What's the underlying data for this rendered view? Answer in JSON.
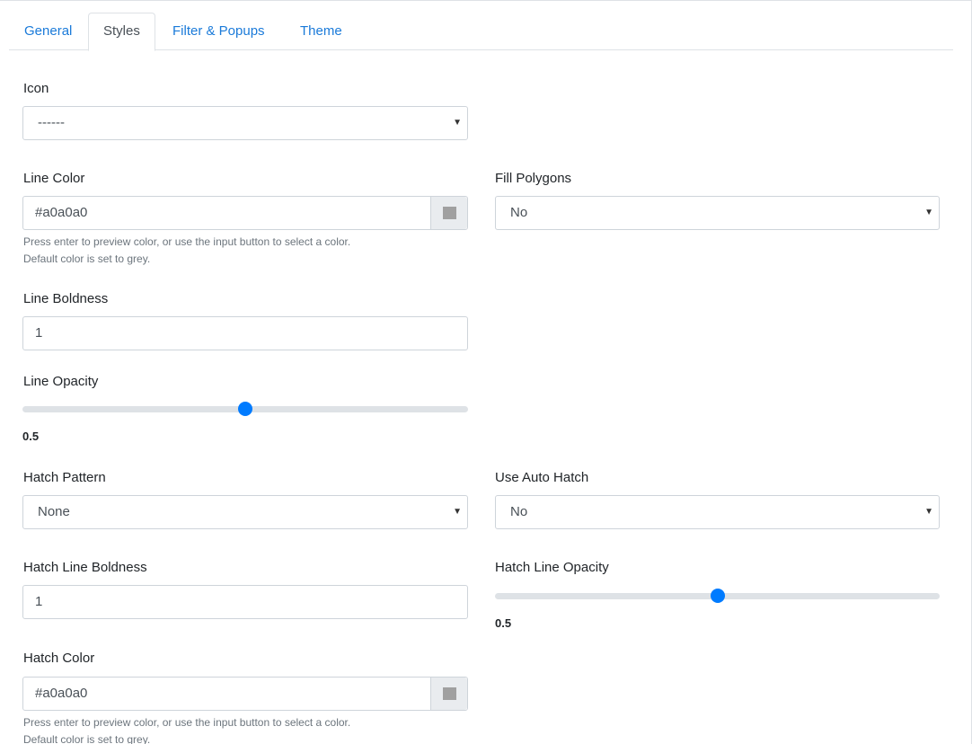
{
  "tabs": [
    {
      "label": "General",
      "active": false
    },
    {
      "label": "Styles",
      "active": true
    },
    {
      "label": "Filter & Popups",
      "active": false
    },
    {
      "label": "Theme",
      "active": false
    }
  ],
  "icon": {
    "label": "Icon",
    "value": "------"
  },
  "line_color": {
    "label": "Line Color",
    "value": "#a0a0a0",
    "help_line1": "Press enter to preview color, or use the input button to select a color.",
    "help_line2": "Default color is set to grey.",
    "swatch_color": "#a0a0a0"
  },
  "fill_polygons": {
    "label": "Fill Polygons",
    "value": "No"
  },
  "line_boldness": {
    "label": "Line Boldness",
    "value": "1"
  },
  "line_opacity": {
    "label": "Line Opacity",
    "value": "0.5",
    "fraction": 0.5
  },
  "hatch_pattern": {
    "label": "Hatch Pattern",
    "value": "None"
  },
  "use_auto_hatch": {
    "label": "Use Auto Hatch",
    "value": "No"
  },
  "hatch_line_boldness": {
    "label": "Hatch Line Boldness",
    "value": "1"
  },
  "hatch_line_opacity": {
    "label": "Hatch Line Opacity",
    "value": "0.5",
    "fraction": 0.5
  },
  "hatch_color": {
    "label": "Hatch Color",
    "value": "#a0a0a0",
    "help_line1": "Press enter to preview color, or use the input button to select a color.",
    "help_line2": "Default color is set to grey.",
    "swatch_color": "#a0a0a0"
  },
  "colors": {
    "tab_link": "#1a7ad9",
    "slider_thumb": "#007bff"
  }
}
